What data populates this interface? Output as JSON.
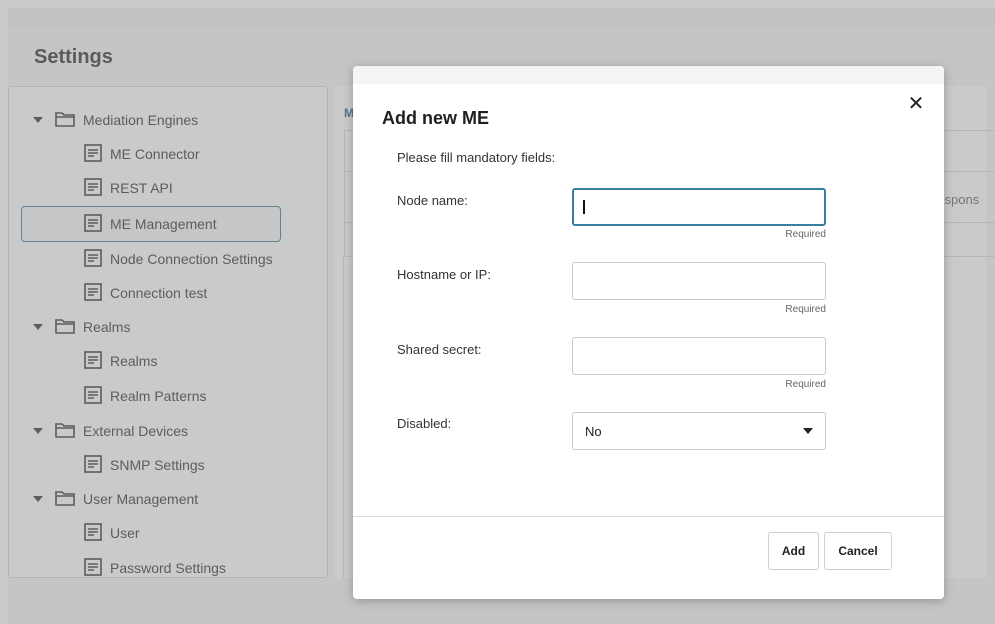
{
  "page": {
    "title": "Settings"
  },
  "sidebar": {
    "items": [
      {
        "label": "Mediation Engines",
        "type": "folder"
      },
      {
        "label": "ME Connector",
        "type": "page"
      },
      {
        "label": "REST API",
        "type": "page"
      },
      {
        "label": "ME Management",
        "type": "page",
        "selected": true
      },
      {
        "label": "Node Connection Settings",
        "type": "page"
      },
      {
        "label": "Connection test",
        "type": "page"
      },
      {
        "label": "Realms",
        "type": "folder"
      },
      {
        "label": "Realms",
        "type": "page"
      },
      {
        "label": "Realm Patterns",
        "type": "page"
      },
      {
        "label": "External Devices",
        "type": "folder"
      },
      {
        "label": "SNMP Settings",
        "type": "page"
      },
      {
        "label": "User Management",
        "type": "folder"
      },
      {
        "label": "User",
        "type": "page"
      },
      {
        "label": "Password Settings",
        "type": "page"
      }
    ]
  },
  "main": {
    "heading_fragment": "M",
    "table_cell_fragment": "respons"
  },
  "dialog": {
    "title": "Add new ME",
    "close_glyph": "✕",
    "instruction": "Please fill mandatory fields:",
    "fields": {
      "node_name": {
        "label": "Node name:",
        "value": "",
        "required_hint": "Required"
      },
      "hostname": {
        "label": "Hostname or IP:",
        "value": "",
        "required_hint": "Required"
      },
      "shared_secret": {
        "label": "Shared secret:",
        "value": "",
        "required_hint": "Required"
      },
      "disabled": {
        "label": "Disabled:",
        "selected": "No"
      }
    },
    "buttons": {
      "add": "Add",
      "cancel": "Cancel"
    }
  },
  "colors": {
    "accent": "#2e6f8e",
    "focus_border": "#3a7da0",
    "overlay": "#969696"
  }
}
